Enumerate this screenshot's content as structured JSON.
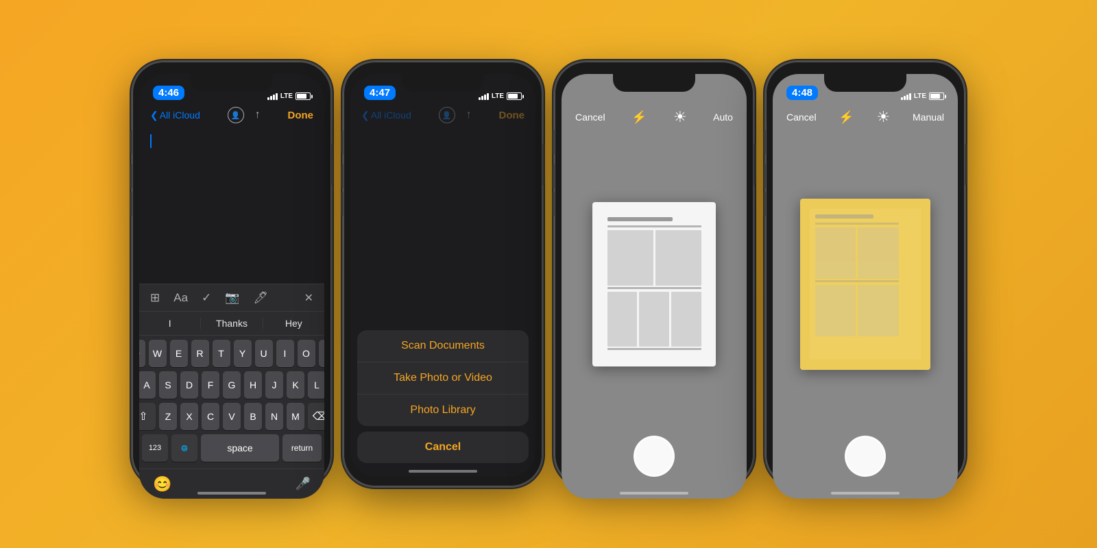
{
  "background_color": "#f5a623",
  "phones": [
    {
      "id": "phone1",
      "time": "4:46",
      "signal": "LTE",
      "screen_type": "notes_keyboard",
      "header": {
        "back_label": "All iCloud",
        "done_label": "Done"
      },
      "keyboard": {
        "predictive": [
          "I",
          "Thanks",
          "Hey"
        ],
        "row1": [
          "Q",
          "W",
          "E",
          "R",
          "T",
          "Y",
          "U",
          "I",
          "O",
          "P"
        ],
        "row2": [
          "A",
          "S",
          "D",
          "F",
          "G",
          "H",
          "J",
          "K",
          "L"
        ],
        "row3": [
          "Z",
          "X",
          "C",
          "V",
          "B",
          "N",
          "M"
        ],
        "specials": {
          "shift": "⇧",
          "delete": "⌫",
          "numbers": "123",
          "space": "space",
          "return": "return"
        }
      }
    },
    {
      "id": "phone2",
      "time": "4:47",
      "signal": "LTE",
      "screen_type": "action_sheet",
      "header": {
        "back_label": "All iCloud",
        "done_label": "Done"
      },
      "action_sheet": {
        "items": [
          "Scan Documents",
          "Take Photo or Video",
          "Photo Library"
        ],
        "cancel_label": "Cancel"
      }
    },
    {
      "id": "phone3",
      "time": "",
      "signal": "",
      "screen_type": "camera_auto",
      "camera_header": {
        "cancel_label": "Cancel",
        "mode_label": "Auto"
      }
    },
    {
      "id": "phone4",
      "time": "4:48",
      "signal": "LTE",
      "screen_type": "camera_manual",
      "camera_header": {
        "cancel_label": "Cancel",
        "mode_label": "Manual"
      }
    }
  ]
}
